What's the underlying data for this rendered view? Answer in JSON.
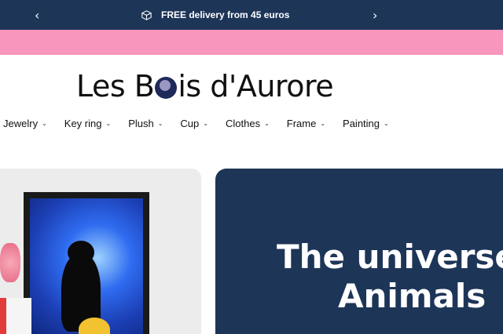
{
  "announcement": {
    "text": "FREE delivery from 45 euros",
    "prev_arrow": "‹",
    "next_arrow": "›",
    "icon": "box-icon"
  },
  "logo": {
    "part1": "Les B",
    "part2": "is d'Aurore"
  },
  "nav": {
    "items": [
      {
        "label": "Jewelry"
      },
      {
        "label": "Key ring"
      },
      {
        "label": "Plush"
      },
      {
        "label": "Cup"
      },
      {
        "label": "Clothes"
      },
      {
        "label": "Frame"
      },
      {
        "label": "Painting"
      }
    ],
    "chevron": "⌄"
  },
  "hero": {
    "title_line1": "The universe",
    "title_line2": "Animals"
  },
  "colors": {
    "navy": "#1d3557",
    "pink": "#f896bd"
  }
}
